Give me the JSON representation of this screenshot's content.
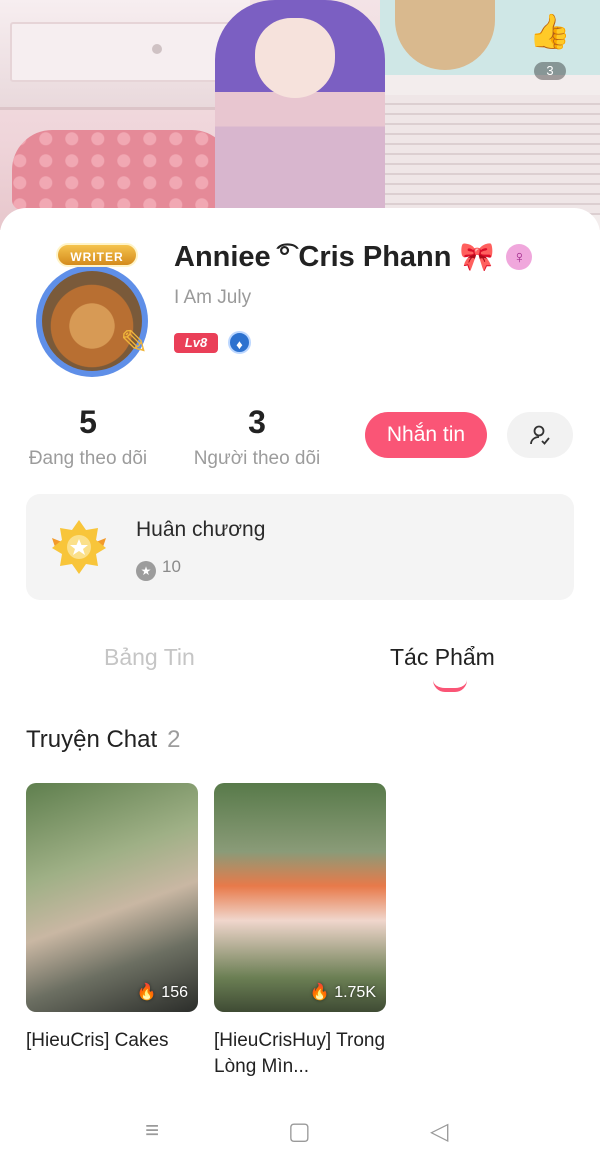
{
  "header": {
    "like_icon": "thumbs-up-icon",
    "like_count": "3"
  },
  "profile": {
    "badge": "WRITER",
    "name": "Anniee ͡° Cris Phann",
    "name_emoji": "🎀",
    "gender_icon": "♀",
    "bio": "I Am July",
    "level": "Lv8",
    "level_icon": "diamond-icon",
    "colors": {
      "accent": "#fa5576",
      "level": "#ea3f58",
      "avatar_ring": "#5f8fe8"
    }
  },
  "stats": {
    "following": {
      "value": "5",
      "label": "Đang theo dõi"
    },
    "followers": {
      "value": "3",
      "label": "Người theo dõi"
    }
  },
  "actions": {
    "message_label": "Nhắn tin",
    "follow_icon": "user-check-icon"
  },
  "medals": {
    "title": "Huân chương",
    "count": "10"
  },
  "tabs": [
    {
      "label": "Bảng Tin",
      "active": false
    },
    {
      "label": "Tác Phẩm",
      "active": true
    }
  ],
  "section": {
    "title": "Truyện Chat",
    "count": "2"
  },
  "stories": [
    {
      "title": "[HieuCris] Cakes",
      "views": "156"
    },
    {
      "title": "[HieuCrisHuy] Trong Lòng Mìn...",
      "views": "1.75K"
    }
  ],
  "navbar": {
    "menu_icon": "menu-icon",
    "home_icon": "square-icon",
    "back_icon": "back-triangle-icon"
  }
}
